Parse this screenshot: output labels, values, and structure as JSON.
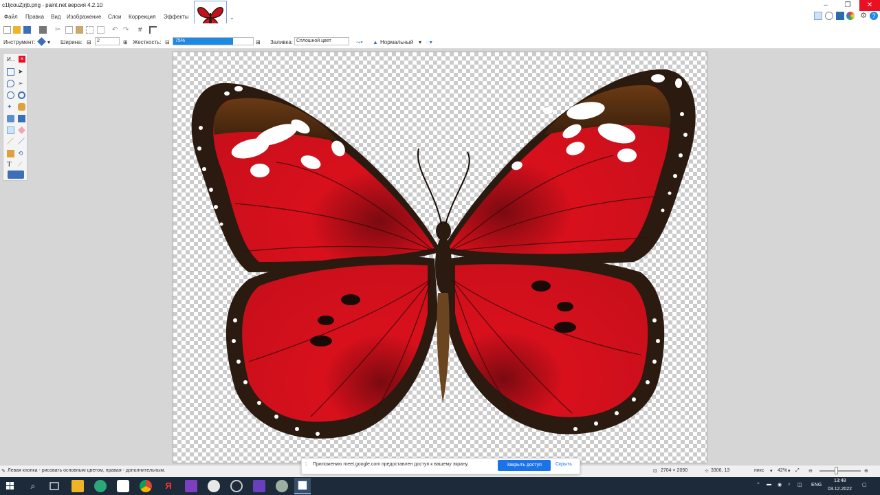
{
  "window": {
    "title": "c1ljcouZjrjb.png - paint.net версия 4.2.10"
  },
  "menu": [
    "Файл",
    "Правка",
    "Вид",
    "Изображение",
    "Слои",
    "Коррекция",
    "Эффекты"
  ],
  "tool_options": {
    "tool_label": "Инструмент:",
    "width_label": "Ширина:",
    "width_value": "2",
    "hardness_label": "Жесткость:",
    "hardness_value": "75%",
    "fill_label": "Заливка:",
    "fill_value": "Сплошной цвет",
    "blend_value": "Нормальный"
  },
  "tools_panel": {
    "title": "И...",
    "close": "×"
  },
  "status": {
    "hint": "Левая кнопка - рисовать основным цветом, правая - дополнительным.",
    "image_size": "2704 × 2090",
    "cursor_pos": "3306, 13",
    "units": "пикс",
    "zoom": "42%"
  },
  "share_banner": {
    "message": "Приложению meet.google.com предоставлен доступ к вашему экрану.",
    "stop_button": "Закрыть доступ",
    "hide_link": "Скрыть"
  },
  "taskbar": {
    "lang": "ENG",
    "time": "13:48",
    "date": "03.12.2022"
  },
  "colors": {
    "accent": "#1a73e8",
    "close": "#e81123",
    "taskbar": "#1c2a3a",
    "hardness_fill": "#1e88e5"
  }
}
